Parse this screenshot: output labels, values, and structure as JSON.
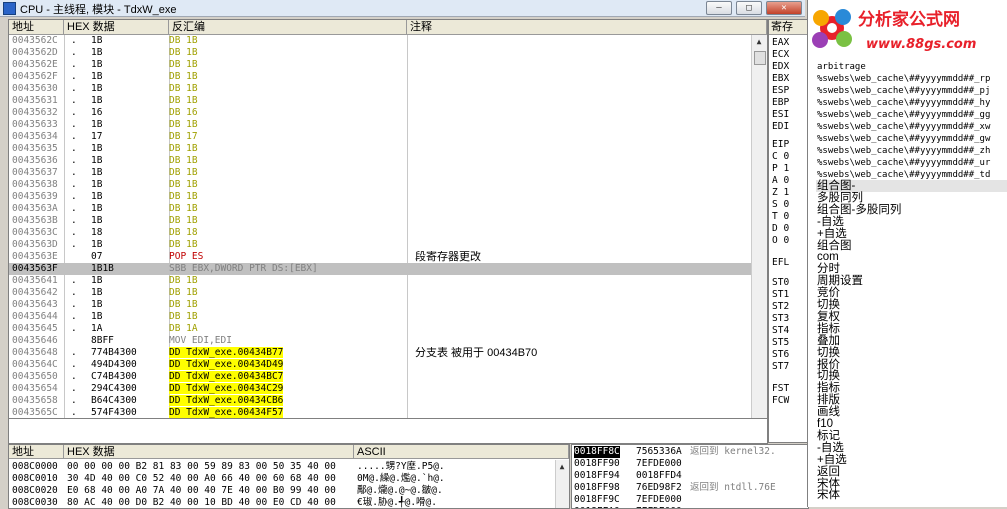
{
  "window": {
    "title": "CPU - 主线程, 模块 - TdxW_exe",
    "min": "—",
    "max": "□",
    "close": "✕"
  },
  "disasm": {
    "headers": {
      "addr": "地址",
      "hex": "HEX 数据",
      "dis": "反汇编",
      "cmt": "注释"
    },
    "rows": [
      {
        "a": "0043562C",
        "m": ".",
        "h": "1B",
        "d": "DB 1B",
        "c": "",
        "t": "db"
      },
      {
        "a": "0043562D",
        "m": ".",
        "h": "1B",
        "d": "DB 1B",
        "c": "",
        "t": "db"
      },
      {
        "a": "0043562E",
        "m": ".",
        "h": "1B",
        "d": "DB 1B",
        "c": "",
        "t": "db"
      },
      {
        "a": "0043562F",
        "m": ".",
        "h": "1B",
        "d": "DB 1B",
        "c": "",
        "t": "db"
      },
      {
        "a": "00435630",
        "m": ".",
        "h": "1B",
        "d": "DB 1B",
        "c": "",
        "t": "db"
      },
      {
        "a": "00435631",
        "m": ".",
        "h": "1B",
        "d": "DB 1B",
        "c": "",
        "t": "db"
      },
      {
        "a": "00435632",
        "m": ".",
        "h": "16",
        "d": "DB 16",
        "c": "",
        "t": "db"
      },
      {
        "a": "00435633",
        "m": ".",
        "h": "1B",
        "d": "DB 1B",
        "c": "",
        "t": "db"
      },
      {
        "a": "00435634",
        "m": ".",
        "h": "17",
        "d": "DB 17",
        "c": "",
        "t": "db"
      },
      {
        "a": "00435635",
        "m": ".",
        "h": "1B",
        "d": "DB 1B",
        "c": "",
        "t": "db"
      },
      {
        "a": "00435636",
        "m": ".",
        "h": "1B",
        "d": "DB 1B",
        "c": "",
        "t": "db"
      },
      {
        "a": "00435637",
        "m": ".",
        "h": "1B",
        "d": "DB 1B",
        "c": "",
        "t": "db"
      },
      {
        "a": "00435638",
        "m": ".",
        "h": "1B",
        "d": "DB 1B",
        "c": "",
        "t": "db"
      },
      {
        "a": "00435639",
        "m": ".",
        "h": "1B",
        "d": "DB 1B",
        "c": "",
        "t": "db"
      },
      {
        "a": "0043563A",
        "m": ".",
        "h": "1B",
        "d": "DB 1B",
        "c": "",
        "t": "db"
      },
      {
        "a": "0043563B",
        "m": ".",
        "h": "1B",
        "d": "DB 1B",
        "c": "",
        "t": "db"
      },
      {
        "a": "0043563C",
        "m": ".",
        "h": "18",
        "d": "DB 18",
        "c": "",
        "t": "db"
      },
      {
        "a": "0043563D",
        "m": ".",
        "h": "1B",
        "d": "DB 1B",
        "c": "",
        "t": "db"
      },
      {
        "a": "0043563E",
        "m": "",
        "h": "07",
        "d": "POP ES",
        "c": "段寄存器更改",
        "t": "red"
      },
      {
        "a": "0043563F",
        "m": "",
        "h": "1B1B",
        "d": "SBB EBX,DWORD PTR DS:[EBX]",
        "c": "",
        "t": "gray",
        "sel": true
      },
      {
        "a": "00435641",
        "m": ".",
        "h": "1B",
        "d": "DB 1B",
        "c": "",
        "t": "db"
      },
      {
        "a": "00435642",
        "m": ".",
        "h": "1B",
        "d": "DB 1B",
        "c": "",
        "t": "db"
      },
      {
        "a": "00435643",
        "m": ".",
        "h": "1B",
        "d": "DB 1B",
        "c": "",
        "t": "db"
      },
      {
        "a": "00435644",
        "m": ".",
        "h": "1B",
        "d": "DB 1B",
        "c": "",
        "t": "db"
      },
      {
        "a": "00435645",
        "m": ".",
        "h": "1A",
        "d": "DB 1A",
        "c": "",
        "t": "db"
      },
      {
        "a": "00435646",
        "m": "",
        "h": "8BFF",
        "d": "MOV EDI,EDI",
        "c": "",
        "t": "gray"
      },
      {
        "a": "00435648",
        "m": ".",
        "h": "774B4300",
        "d": "DD TdxW_exe.00434B77",
        "c": "分支表 被用于 00434B70",
        "t": "yel"
      },
      {
        "a": "0043564C",
        "m": ".",
        "h": "494D4300",
        "d": "DD TdxW_exe.00434D49",
        "c": "",
        "t": "yel"
      },
      {
        "a": "00435650",
        "m": ".",
        "h": "C74B4300",
        "d": "DD TdxW_exe.00434BC7",
        "c": "",
        "t": "yel"
      },
      {
        "a": "00435654",
        "m": ".",
        "h": "294C4300",
        "d": "DD TdxW_exe.00434C29",
        "c": "",
        "t": "yel"
      },
      {
        "a": "00435658",
        "m": ".",
        "h": "B64C4300",
        "d": "DD TdxW_exe.00434CB6",
        "c": "",
        "t": "yel"
      },
      {
        "a": "0043565C",
        "m": ".",
        "h": "574F4300",
        "d": "DD TdxW_exe.00434F57",
        "c": "",
        "t": "yel"
      }
    ]
  },
  "registers": {
    "header": "寄存",
    "items": [
      "EAX",
      "ECX",
      "EDX",
      "EBX",
      "ESP",
      "EBP",
      "ESI",
      "EDI",
      "EIP",
      "C 0",
      "P 1",
      "A 0",
      "Z 1",
      "S 0",
      "T 0",
      "D 0",
      "O 0",
      "EFL",
      "ST0",
      "ST1",
      "ST2",
      "ST3",
      "ST4",
      "ST5",
      "ST6",
      "ST7",
      "FST",
      "FCW"
    ]
  },
  "dump": {
    "headers": {
      "addr": "地址",
      "hex": "HEX 数据",
      "ascii": "ASCII"
    },
    "rows": [
      {
        "a": "008C0000",
        "h": "00 00 00 00 B2 81 83 00 59 89 83 00 50 35 40 00",
        "s": ".....甥?Y塺.P5@."
      },
      {
        "a": "008C0010",
        "h": "30 4D 40 00 C0 52 40 00 A0 66 40 00 60 68 40 00",
        "s": "0M@.繰@.爁@.`h@."
      },
      {
        "a": "008C0020",
        "h": "E0 68 40 00 A0 7A 40 00 40 7E 40 00 B0 99 40 00",
        "s": "鄅@.爖@.@~@.皺@."
      },
      {
        "a": "008C0030",
        "h": "80 AC 40 00 D0 B2 40 00 10 BD 40 00 E0 CD 40 00",
        "s": "€琡.胁@.╃@.嗗@."
      }
    ]
  },
  "stack": {
    "rows": [
      {
        "a": "0018FF8C",
        "v": "7565336A",
        "c": "返回到 kernel32.",
        "sel": true
      },
      {
        "a": "0018FF90",
        "v": "7EFDE000",
        "c": ""
      },
      {
        "a": "0018FF94",
        "v": "0018FFD4",
        "c": ""
      },
      {
        "a": "0018FF98",
        "v": "76ED98F2",
        "c": "返回到 ntdll.76E"
      },
      {
        "a": "0018FF9C",
        "v": "7EFDE000",
        "c": ""
      },
      {
        "a": "0018FFA0",
        "v": "7EFDE000",
        "c": ""
      }
    ]
  },
  "side": {
    "logo_text": "分析家公式网",
    "logo_url": "www.88gs.com",
    "partial_top": [
      "ar…",
      "arbitrage"
    ],
    "cache_lines": [
      "arbitrage",
      "%swebs\\web_cache\\##yyyymmdd##_rp",
      "%swebs\\web_cache\\##yyyymmdd##_pj",
      "%swebs\\web_cache\\##yyyymmdd##_hy",
      "%swebs\\web_cache\\##yyyymmdd##_gg",
      "%swebs\\web_cache\\##yyyymmdd##_xw",
      "%swebs\\web_cache\\##yyyymmdd##_gw",
      "%swebs\\web_cache\\##yyyymmdd##_zh",
      "%swebs\\web_cache\\##yyyymmdd##_ur",
      "%swebs\\web_cache\\##yyyymmdd##_td"
    ],
    "cn_lines": [
      "组合图-",
      "多股同列",
      "组合图-多股同列",
      "-自选",
      "+自选",
      "组合图",
      "com",
      "分时",
      "周期设置",
      "竞价",
      "切换",
      "复权",
      "指标",
      "叠加",
      "切换",
      "报价",
      "切换",
      "指标",
      "排版",
      "画线",
      "f10",
      "标记",
      "-自选",
      "+自选",
      "返回",
      "宋体",
      "宋体"
    ]
  },
  "colors": {
    "highlight_yellow": "#ffff00",
    "db_text": "#a0a000",
    "red_text": "#c00000"
  }
}
